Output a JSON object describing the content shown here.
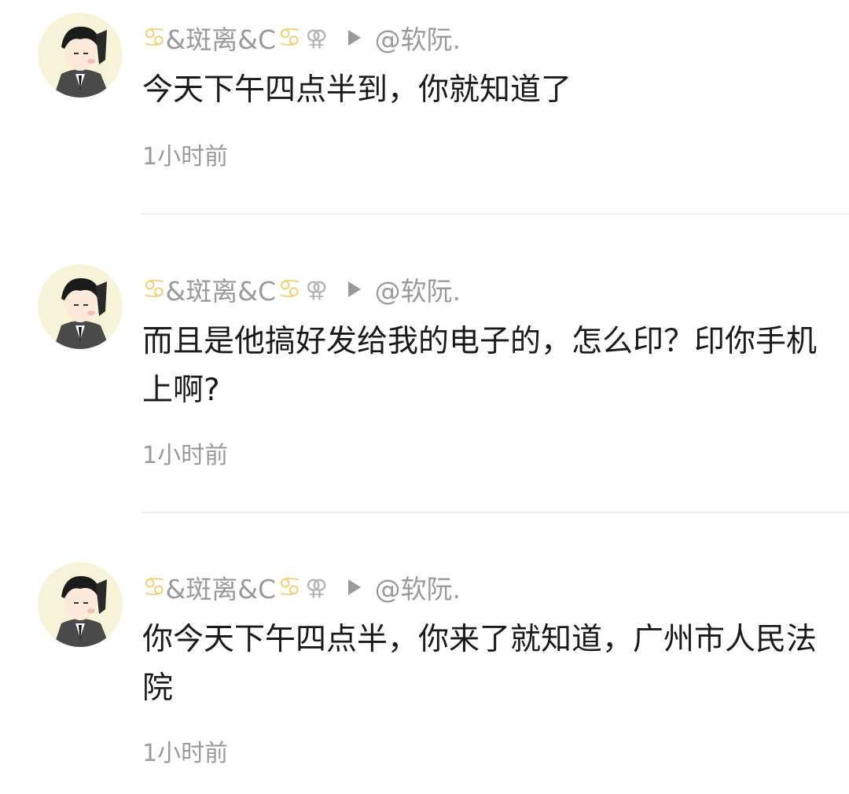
{
  "comments": [
    {
      "author_prefix_symbol": "♋",
      "author_name": "&斑离&C",
      "author_suffix_symbol": "♋",
      "gender_symbol": "⚢",
      "reply_to": "@软阮.",
      "text": "今天下午四点半到，你就知道了",
      "time": "1小时前"
    },
    {
      "author_prefix_symbol": "♋",
      "author_name": "&斑离&C",
      "author_suffix_symbol": "♋",
      "gender_symbol": "⚢",
      "reply_to": "@软阮.",
      "text": "而且是他搞好发给我的电子的，怎么印？印你手机上啊?",
      "time": "1小时前"
    },
    {
      "author_prefix_symbol": "♋",
      "author_name": "&斑离&C",
      "author_suffix_symbol": "♋",
      "gender_symbol": "⚢",
      "reply_to": "@软阮.",
      "text": "你今天下午四点半，你来了就知道，广州市人民法院",
      "time": "1小时前"
    }
  ],
  "colors": {
    "zodiac": "#f1d27a",
    "meta_gray": "#9a9a9a",
    "text": "#1a1a1a",
    "divider": "#eeeeee",
    "avatar_bg": "#f7f3d9"
  },
  "icons": {
    "avatar": "avatar-icon",
    "arrow": "reply-arrow-icon",
    "gender": "gender-icon",
    "zodiac": "zodiac-cancer-icon"
  }
}
